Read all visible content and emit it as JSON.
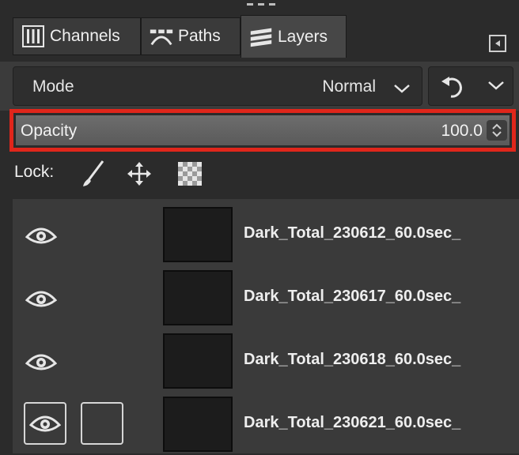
{
  "tabs": [
    {
      "label": "Channels",
      "icon": "channels-icon"
    },
    {
      "label": "Paths",
      "icon": "paths-icon"
    },
    {
      "label": "Layers",
      "icon": "layers-icon",
      "active": true
    }
  ],
  "mode": {
    "label": "Mode",
    "value": "Normal"
  },
  "opacity": {
    "label": "Opacity",
    "value": "100.0"
  },
  "lock": {
    "label": "Lock:"
  },
  "layers": [
    {
      "name": "Dark_Total_230612_60.0sec_",
      "visible": true
    },
    {
      "name": "Dark_Total_230617_60.0sec_",
      "visible": true
    },
    {
      "name": "Dark_Total_230618_60.0sec_",
      "visible": true
    },
    {
      "name": "Dark_Total_230621_60.0sec_",
      "visible": true,
      "selected": true
    }
  ],
  "colors": {
    "highlight": "#e0261b",
    "panel": "#2b2b2b",
    "row": "#3a3a3a"
  }
}
